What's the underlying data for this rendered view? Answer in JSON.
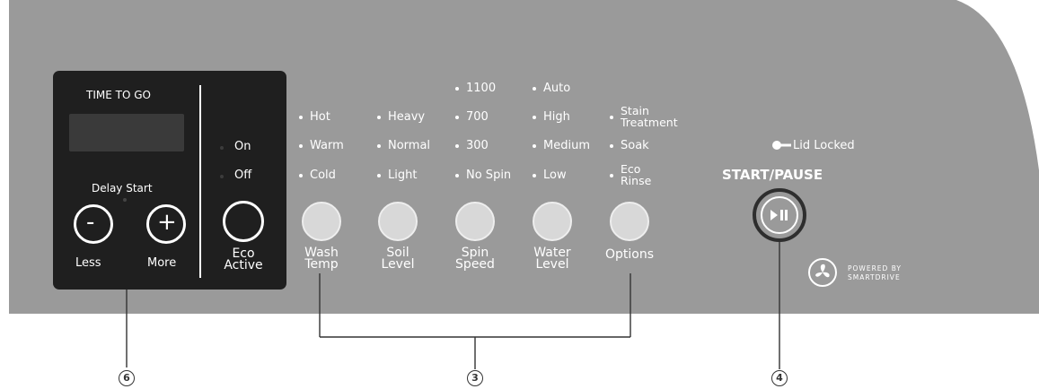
{
  "timer": {
    "title": "TIME TO GO",
    "delay_start": "Delay Start",
    "less_label": "Less",
    "more_label": "More",
    "minus_symbol": "-",
    "plus_symbol": "+"
  },
  "eco": {
    "on_label": "On",
    "off_label": "Off",
    "button_label_1": "Eco",
    "button_label_2": "Active"
  },
  "wash_temp": {
    "label_1": "Wash",
    "label_2": "Temp",
    "options": [
      "Hot",
      "Warm",
      "Cold"
    ]
  },
  "soil_level": {
    "label_1": "Soil",
    "label_2": "Level",
    "options": [
      "Heavy",
      "Normal",
      "Light"
    ]
  },
  "spin_speed": {
    "label_1": "Spin",
    "label_2": "Speed",
    "options": [
      "1100",
      "700",
      "300",
      "No Spin"
    ]
  },
  "water_level": {
    "label_1": "Water",
    "label_2": "Level",
    "options": [
      "Auto",
      "High",
      "Medium",
      "Low"
    ]
  },
  "options": {
    "label": "Options",
    "stain_1": "Stain",
    "stain_2": "Treatment",
    "soak": "Soak",
    "eco_1": "Eco",
    "eco_2": "Rinse"
  },
  "lid_locked": "Lid Locked",
  "start_pause": "START/PAUSE",
  "powered_by": "POWERED BY",
  "smartdrive": "SMARTDRIVE",
  "callouts": {
    "c6": "6",
    "c3": "3",
    "c4": "4"
  },
  "colors": {
    "panel": "#9a9a9a",
    "display_panel": "#1f1f1f",
    "screen": "#3a3a3a",
    "button": "#d8d8d8",
    "leader": "#333333"
  }
}
